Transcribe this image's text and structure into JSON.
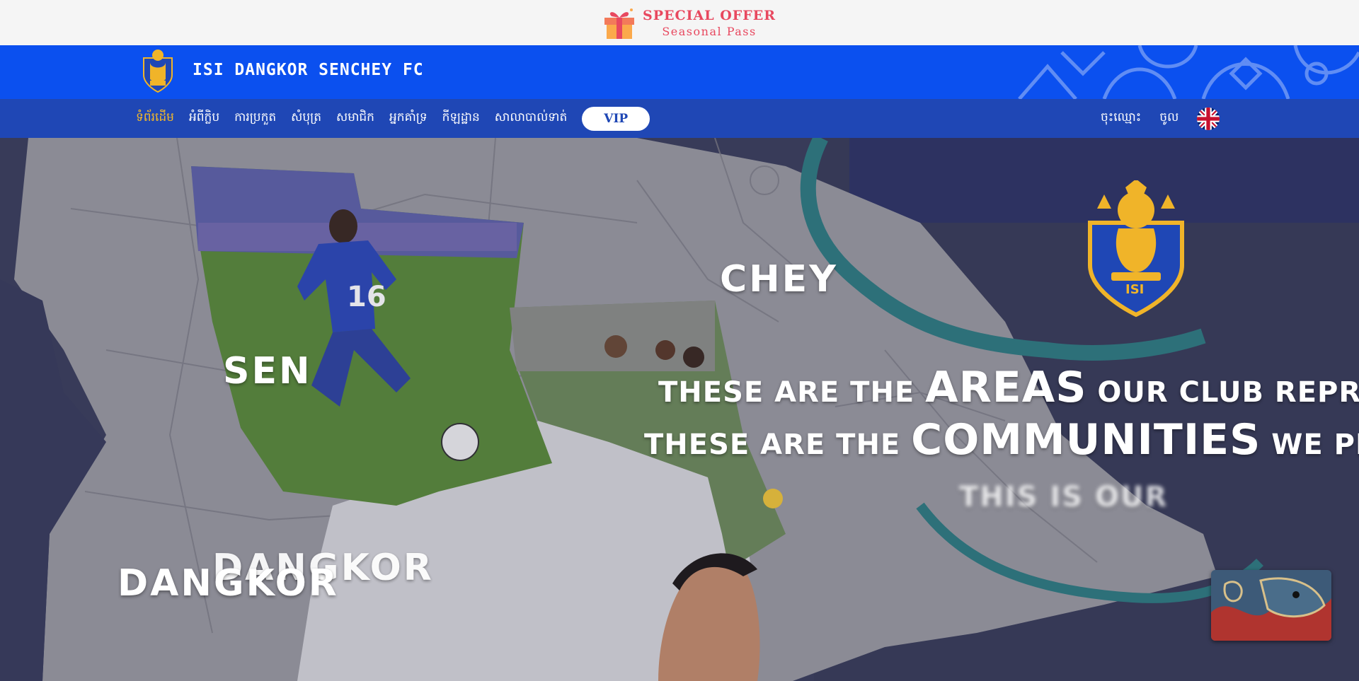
{
  "promo": {
    "title": "SPECIAL OFFER",
    "subtitle": "Seasonal Pass",
    "icon": "gift-icon"
  },
  "brand": {
    "name": "ISI DANGKOR SENCHEY FC",
    "logo": "club-crest-logo"
  },
  "nav": {
    "items": [
      {
        "label": "ទំព័រដើម",
        "active": true
      },
      {
        "label": "អំពីក្លិប"
      },
      {
        "label": "ការប្រកួត"
      },
      {
        "label": "សំបុត្រ"
      },
      {
        "label": "សមាជិក"
      },
      {
        "label": "អ្នកគាំទ្រ"
      },
      {
        "label": "កីឡដ្ឋាន"
      },
      {
        "label": "សាលាបាល់ទាត់"
      }
    ],
    "vip_label": "VIP",
    "register_label": "ចុះឈ្មោះ",
    "login_label": "ចូល",
    "language_icon": "uk-flag-icon"
  },
  "hero": {
    "area_chey": "CHEY",
    "area_sen": "SEN",
    "area_dangkor_a": "DANGKOR",
    "area_dangkor_b": "DANGKOR",
    "line1_a": "THESE ARE THE ",
    "line1_big": "AREAS",
    "line1_b": " OUR CLUB REPRESENTS,",
    "line2_a": "THESE ARE THE ",
    "line2_big": "COMMUNITIES",
    "line2_b": " WE PLAY FOR,",
    "line3": "THIS IS OUR"
  },
  "colors": {
    "promo_bg": "#f5f5f5",
    "promo_accent": "#e8485f",
    "brand_blue": "#0b50ef",
    "nav_blue": "#1f47b5",
    "active_nav": "#f5b928",
    "crest_gold": "#f0b429"
  }
}
